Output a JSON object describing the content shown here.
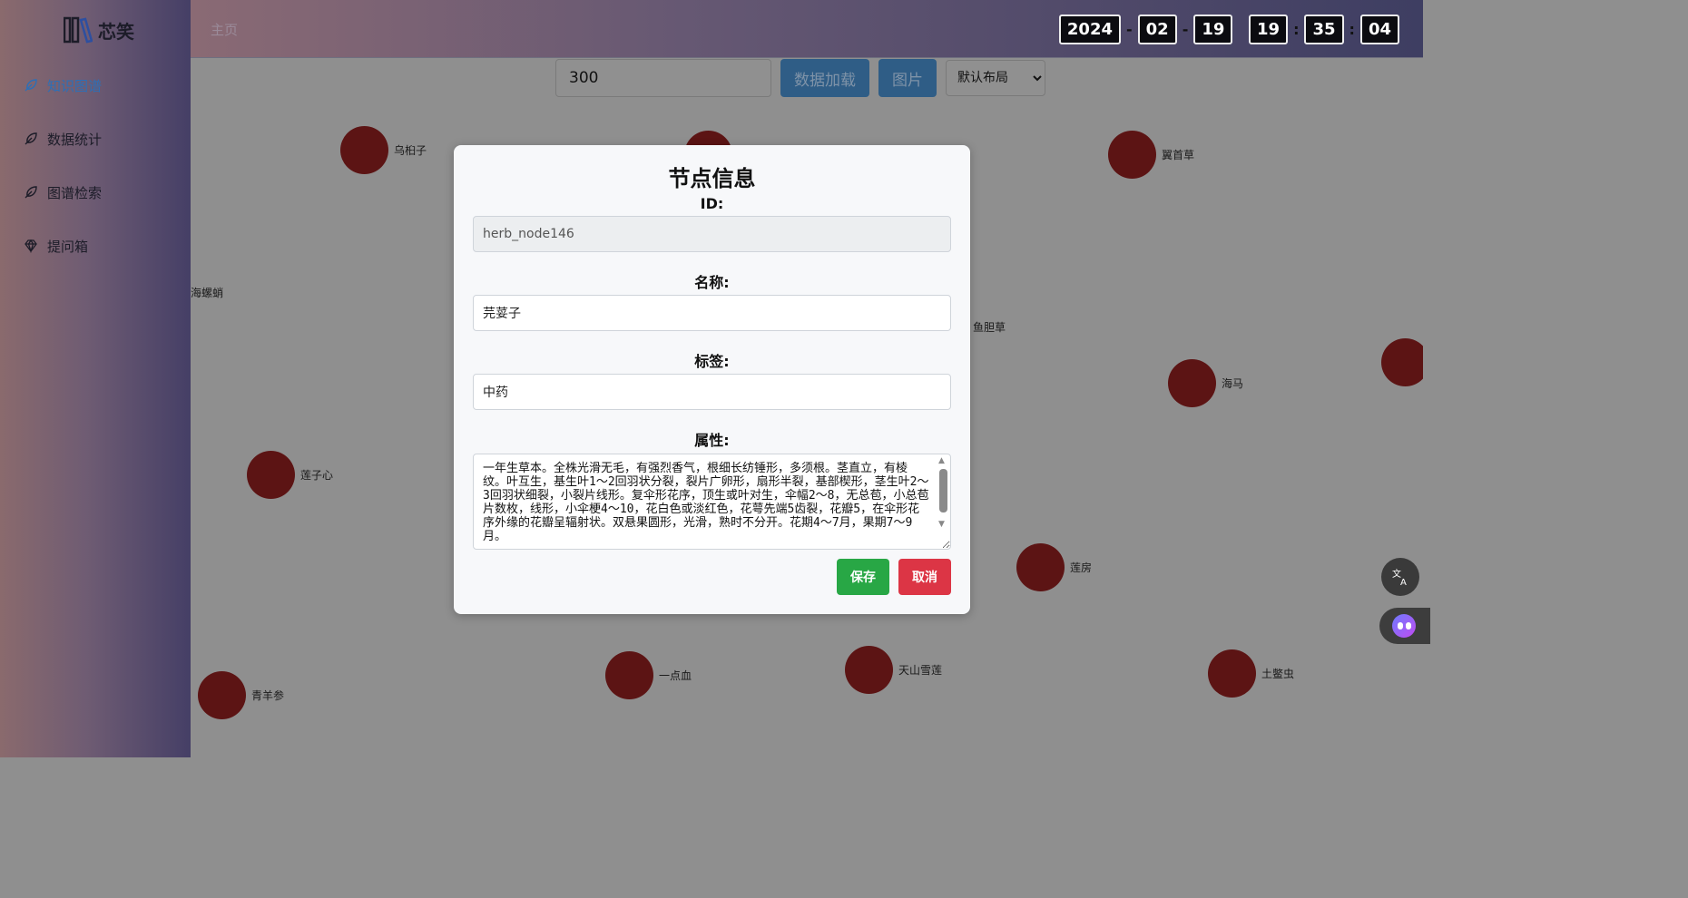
{
  "brand": {
    "name": "芯笑"
  },
  "sidebar": {
    "items": [
      {
        "label": "知识图谱",
        "active": true
      },
      {
        "label": "数据统计",
        "active": false
      },
      {
        "label": "图谱检索",
        "active": false
      },
      {
        "label": "提问箱",
        "active": false
      }
    ]
  },
  "header": {
    "breadcrumb": "主页",
    "clock": {
      "year": "2024",
      "month": "02",
      "day": "19",
      "hour": "19",
      "minute": "35",
      "second": "04"
    }
  },
  "toolbar": {
    "limit_value": "300",
    "load_button": "数据加载",
    "image_button": "图片",
    "layout_selected": "默认布局"
  },
  "graph": {
    "node_color": "#5c1414",
    "nodes": [
      "乌桕子",
      "翼首草",
      "海螺蛸",
      "鱼胆草",
      "海马",
      "莲子心",
      "莲房",
      "青羊参",
      "一点血",
      "天山雪莲",
      "土鳖虫"
    ]
  },
  "modal": {
    "title": "节点信息",
    "id_label": "ID:",
    "id_value": "herb_node146",
    "name_label": "名称:",
    "name_value": "芫荽子",
    "tag_label": "标签:",
    "tag_value": "中药",
    "props_label": "属性:",
    "props_value": "一年生草本。全株光滑无毛，有强烈香气，根细长纺锤形，多须根。茎直立，有棱纹。叶互生，基生叶1～2回羽状分裂，裂片广卵形，扇形半裂，基部楔形，茎生叶2～3回羽状细裂，小裂片线形。复伞形花序，顶生或叶对生，伞幅2～8，无总苞，小总苞片数枚，线形，小伞梗4～10，花白色或淡红色，花萼先端5齿裂，花瓣5，在伞形花序外缘的花瓣呈辐射状。双悬果圆形，光滑，熟时不分开。花期4～7月，果期7～9月。",
    "save_button": "保存",
    "cancel_button": "取消"
  }
}
